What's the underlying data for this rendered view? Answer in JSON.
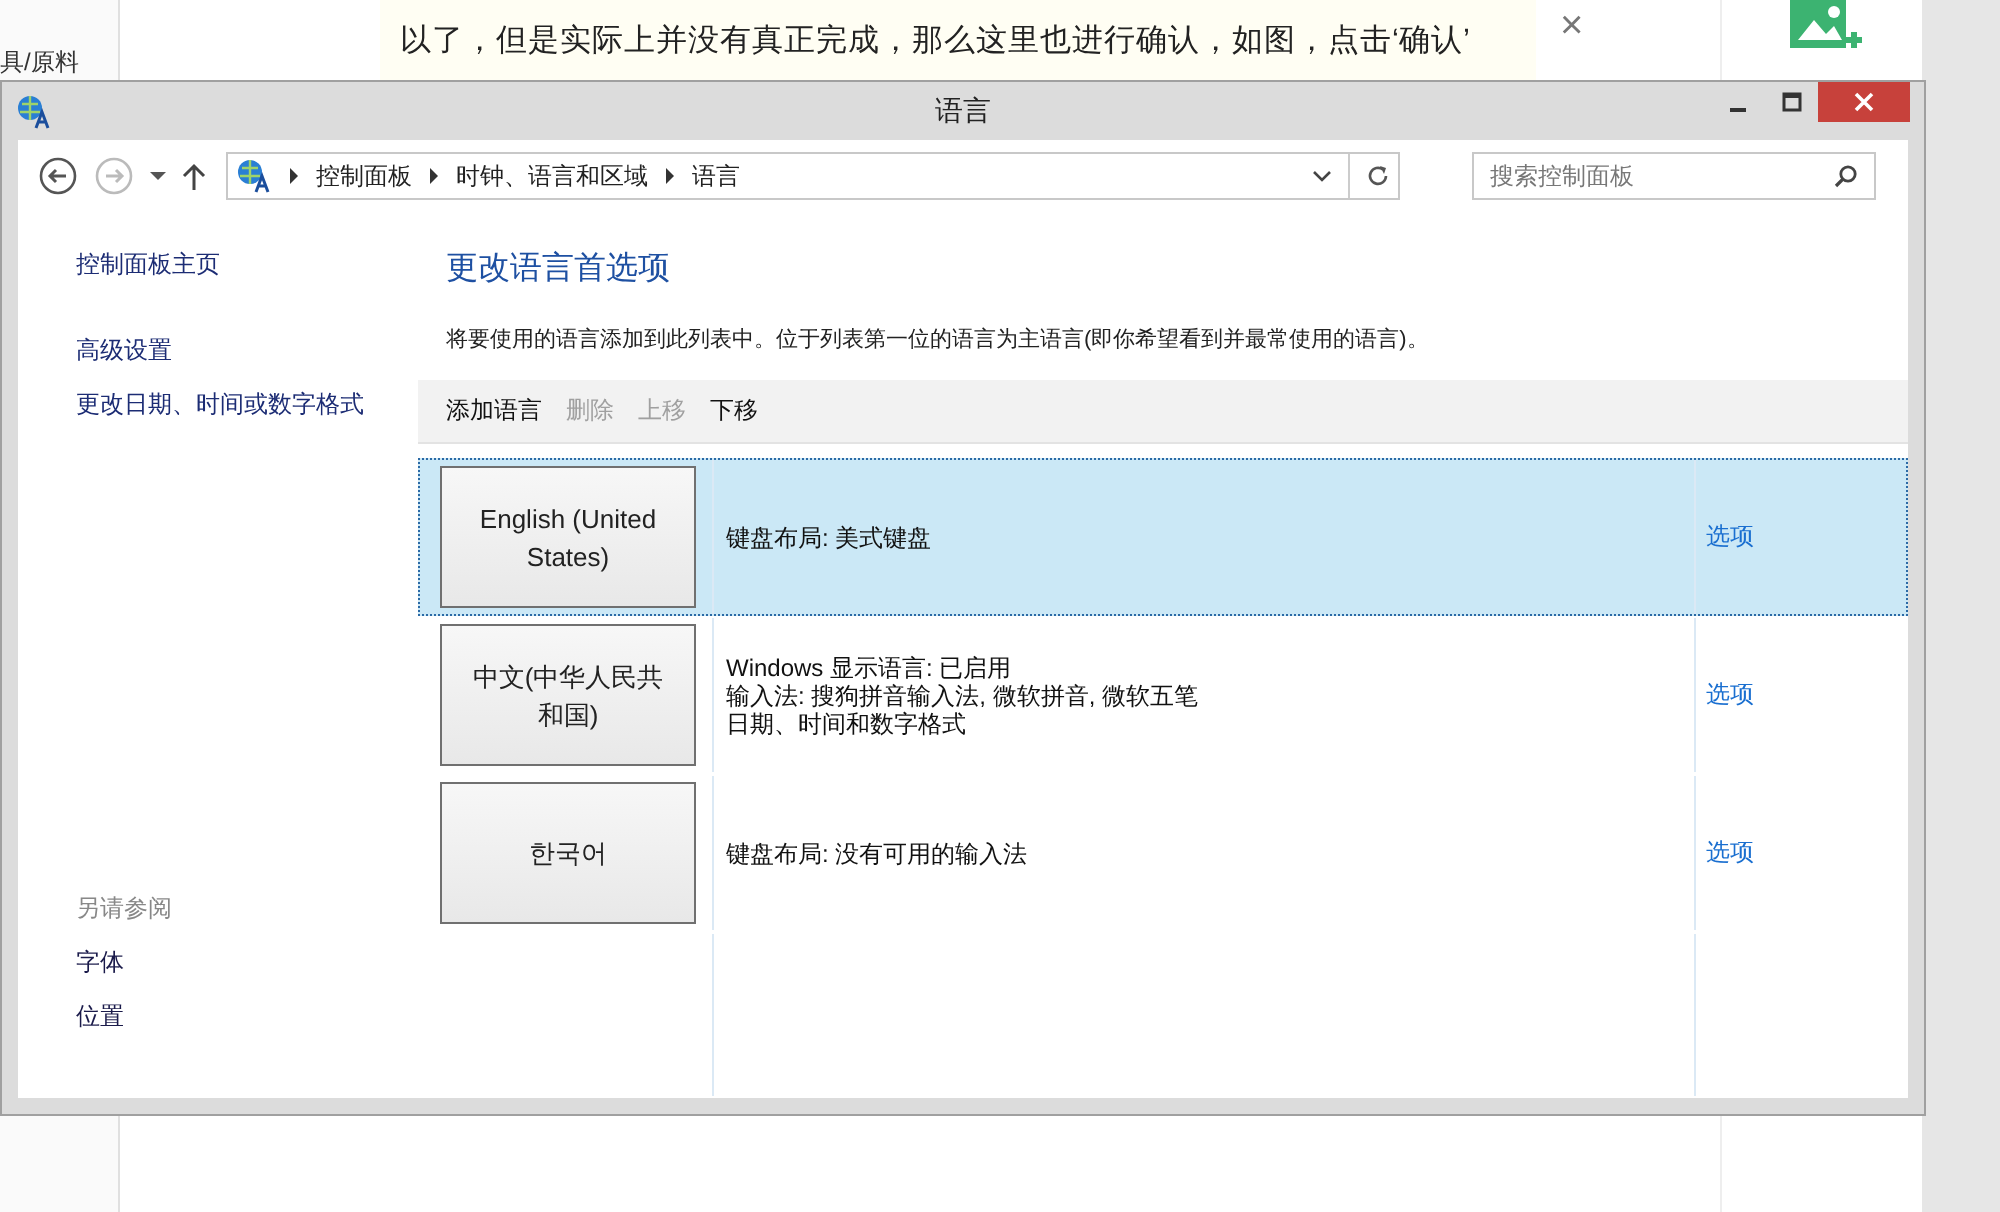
{
  "background_page": {
    "left_text": "具/原料",
    "article_line": "以了，但是实际上并没有真正完成，那么这里也进行确认，如图，点击‘确认’",
    "close_glyph": "×"
  },
  "window": {
    "title": "语言"
  },
  "address_bar": {
    "breadcrumbs": [
      "控制面板",
      "时钟、语言和区域",
      "语言"
    ]
  },
  "search": {
    "placeholder": "搜索控制面板"
  },
  "sidebar": {
    "items": [
      "控制面板主页",
      "高级设置",
      "更改日期、时间或数字格式"
    ],
    "see_also_heading": "另请参阅",
    "see_also": [
      "字体",
      "位置"
    ]
  },
  "main": {
    "heading": "更改语言首选项",
    "description": "将要使用的语言添加到此列表中。位于列表第一位的语言为主语言(即你希望看到并最常使用的语言)。",
    "toolbar": [
      {
        "label": "添加语言",
        "disabled": false
      },
      {
        "label": "删除",
        "disabled": true
      },
      {
        "label": "上移",
        "disabled": true
      },
      {
        "label": "下移",
        "disabled": false
      }
    ],
    "languages": [
      {
        "name": "English (United States)",
        "details": [
          "键盘布局: 美式键盘"
        ],
        "options": "选项",
        "selected": true
      },
      {
        "name": "中文(中华人民共和国)",
        "details": [
          "Windows 显示语言: 已启用",
          "输入法: 搜狗拼音输入法, 微软拼音, 微软五笔",
          "日期、时间和数字格式"
        ],
        "options": "选项",
        "selected": false
      },
      {
        "name": "한국어",
        "details": [
          "键盘布局: 没有可用的输入法"
        ],
        "options": "选项",
        "selected": false
      }
    ]
  }
}
